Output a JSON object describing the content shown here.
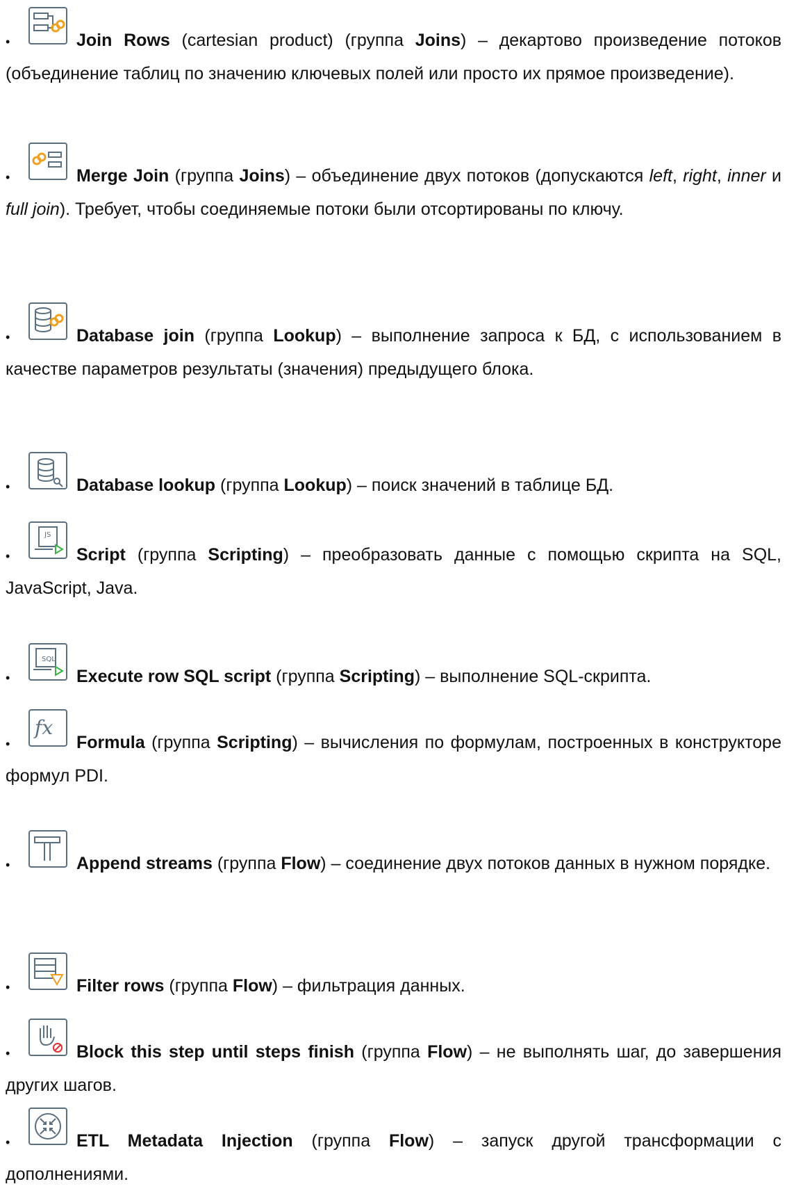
{
  "items": [
    {
      "icon": "join-rows-icon",
      "name": "Join Rows",
      "rest1": " (cartesian product) (группа ",
      "group": "Joins",
      "desc": ") – декартово произведение потоков (объединение таблиц по значению ключевых полей или просто их прямое произведение)."
    },
    {
      "icon": "merge-join-icon",
      "name": "Merge Join",
      "rest1": " (группа ",
      "group": "Joins",
      "desc_a": ") – объединение двух потоков (допускаются ",
      "it1": "left",
      "sep1": ", ",
      "it2": "right",
      "sep2": ", ",
      "it3": "inner",
      "sep3": " и ",
      "it4": "full join",
      "desc_b": "). Требует, чтобы соединяемые потоки были отсортированы по ключу."
    },
    {
      "icon": "database-join-icon",
      "name": "Database join",
      "rest1": " (группа ",
      "group": "Lookup",
      "desc": ") – выполнение запроса к БД, с использованием в качестве параметров результаты (значения) предыдущего блока."
    },
    {
      "icon": "database-lookup-icon",
      "name": "Database lookup",
      "rest1": " (группа ",
      "group": "Lookup",
      "desc": ") – поиск значений в таблице БД."
    },
    {
      "icon": "script-icon",
      "name": "Script",
      "rest1": " (группа ",
      "group": "Scripting",
      "desc": ") – преобразовать данные с помощью скрипта на SQL, JavaScript, Java."
    },
    {
      "icon": "execute-sql-script-icon",
      "name": "Execute row SQL script",
      "rest1": " (группа ",
      "group": "Scripting",
      "desc": ") – выполнение SQL-скрипта."
    },
    {
      "icon": "formula-icon",
      "name": "Formula",
      "rest1": " (группа ",
      "group": "Scripting",
      "desc": ") – вычисления по формулам, построенных в конструкторе формул PDI."
    },
    {
      "icon": "append-streams-icon",
      "name": "Append streams",
      "rest1": " (группа ",
      "group": "Flow",
      "desc": ") – соединение двух потоков данных в нужном порядке."
    },
    {
      "icon": "filter-rows-icon",
      "name": "Filter rows",
      "rest1": " (группа ",
      "group": "Flow",
      "desc": ") – фильтрация данных."
    },
    {
      "icon": "block-step-icon",
      "name": "Block this step until steps finish",
      "rest1": " (группа ",
      "group": "Flow",
      "desc": ") – не выполнять шаг, до завершения других шагов."
    },
    {
      "icon": "metadata-injection-icon",
      "name": "ETL Metadata Injection",
      "rest1": " (группа ",
      "group": "Flow",
      "desc": ") – запуск другой трансформации с дополнениями."
    }
  ],
  "formula_glyph": "fx",
  "sql_glyph": "SQL",
  "js_glyph": "JS",
  "bullet": "•",
  "colors": {
    "icon_stroke": "#5a6f80",
    "accent_orange": "#f0a020",
    "accent_green": "#3cb043",
    "accent_red": "#e03030"
  }
}
